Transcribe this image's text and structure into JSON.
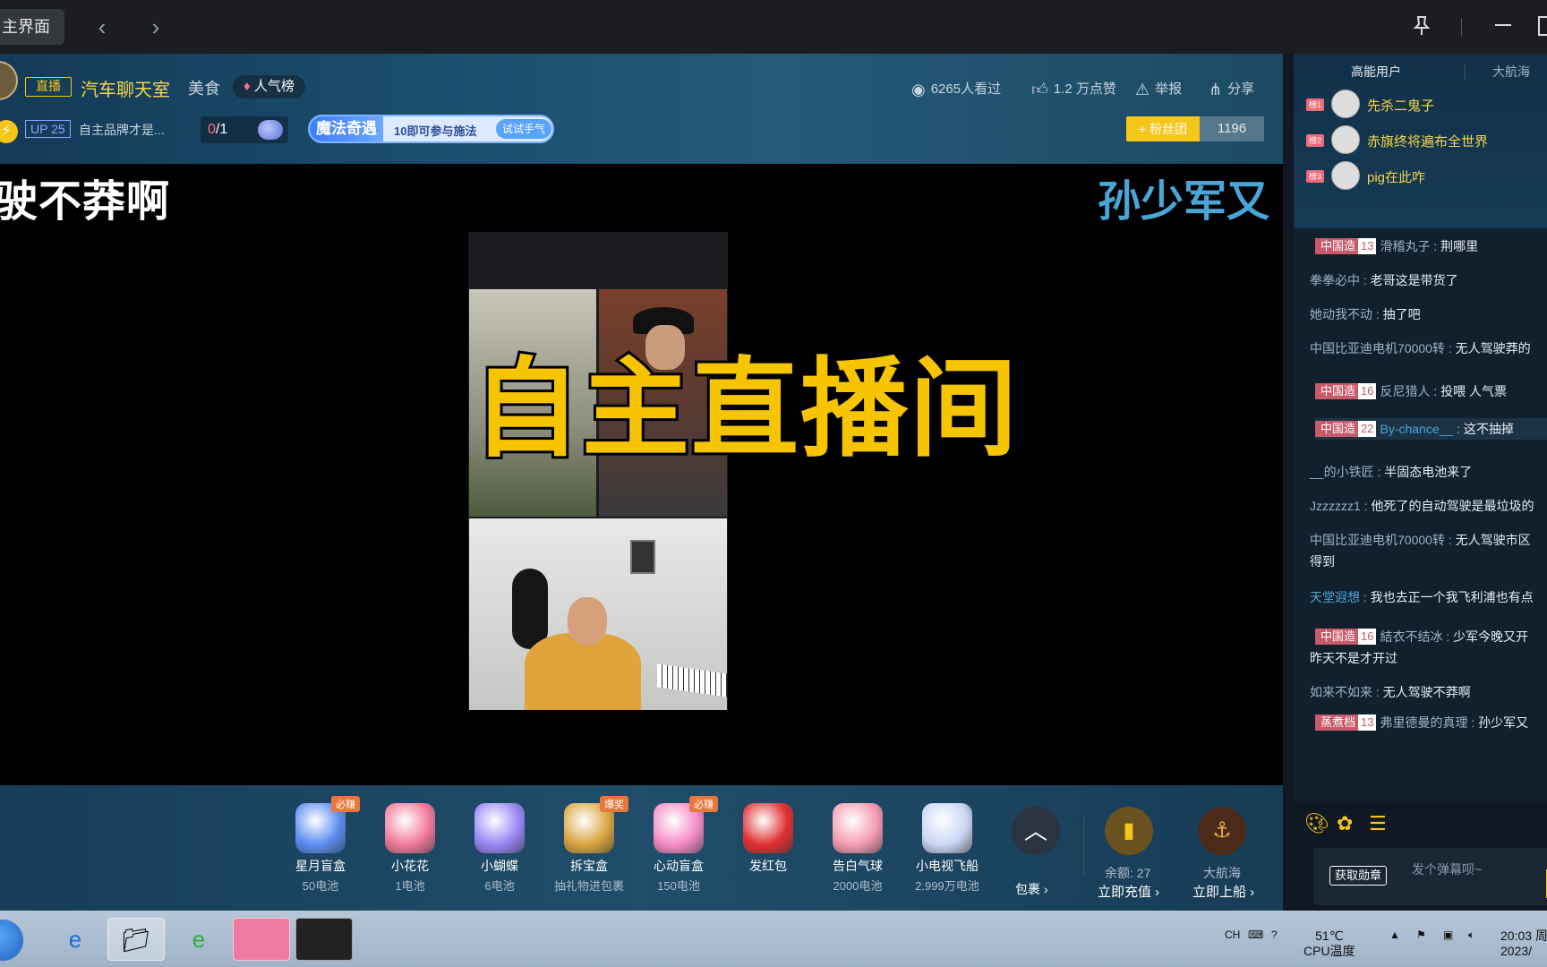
{
  "window": {
    "home_tab": "主界面",
    "back_icon": "‹",
    "forward_icon": "›",
    "pin_icon": "pin-icon",
    "minimize_icon": "minimize-icon"
  },
  "header": {
    "live_tag": "直播",
    "room_title": "汽车聊天室",
    "area": "美食",
    "rank_label": "人气榜",
    "up_level": "UP 25",
    "up_desc": "自主品牌才是...",
    "task_done": "0",
    "task_total": "/1",
    "magic_title": "魔法奇遇",
    "magic_tip": "10即可参与施法",
    "magic_button": "试试手气",
    "views": "6265人看过",
    "likes": "1.2 万点赞",
    "report": "举报",
    "share": "分享",
    "fan_button": "+ 粉丝团",
    "fan_count": "1196"
  },
  "video": {
    "caption_left": "驶不莽啊",
    "caption_right": "孙少军又",
    "overlay_title": "自主直播间"
  },
  "gifts": {
    "items": [
      {
        "name": "星月盲盒",
        "price": "50电池",
        "badge": "必赚",
        "color": "#5b8cf2"
      },
      {
        "name": "小花花",
        "price": "1电池",
        "badge": "",
        "color": "#f27a9a"
      },
      {
        "name": "小蝴蝶",
        "price": "6电池",
        "badge": "",
        "color": "#9a86f5"
      },
      {
        "name": "拆宝盒",
        "price": "抽礼物进包裹",
        "badge": "爆奖",
        "color": "#d9a640"
      },
      {
        "name": "心动盲盒",
        "price": "150电池",
        "badge": "必赚",
        "color": "#f58bc7"
      },
      {
        "name": "发红包",
        "price": "",
        "badge": "",
        "color": "#e03030"
      },
      {
        "name": "告白气球",
        "price": "2000电池",
        "badge": "",
        "color": "#f59cb2"
      },
      {
        "name": "小电视飞船",
        "price": "2.999万电池",
        "badge": "",
        "color": "#c9d6f2"
      }
    ],
    "more_label": "包裹 ›",
    "balance": "余额: 27",
    "recharge": "立即充值 ›",
    "ship_label": "大航海",
    "board": "立即上船 ›"
  },
  "panel": {
    "tab_vip": "高能用户",
    "tab_ship": "大航海",
    "vip_users": [
      {
        "rank": "榜1",
        "name": "先杀二鬼子"
      },
      {
        "rank": "榜2",
        "name": "赤旗终将遍布全世界"
      },
      {
        "rank": "榜3",
        "name": "pig在此咋"
      }
    ],
    "messages": [
      {
        "medal": "中国造",
        "lvl": "13",
        "user": "滑稽丸子",
        "text": "荆哪里"
      },
      {
        "medal": "",
        "lvl": "",
        "user": "拳拳必中",
        "text": "老哥这是带货了"
      },
      {
        "medal": "",
        "lvl": "",
        "user": "她动我不动",
        "text": "抽了吧"
      },
      {
        "medal": "",
        "lvl": "",
        "user": "中国比亚迪电机70000转",
        "text": "无人驾驶莽的"
      },
      {
        "medal": "中国造",
        "lvl": "16",
        "user": "反尼猎人",
        "text": "投喂 人气票"
      },
      {
        "medal": "中国造",
        "lvl": "22",
        "user": "By-chance__",
        "text": "这不抽掉"
      },
      {
        "medal": "",
        "lvl": "",
        "user": "__的小铁匠",
        "text": "半固态电池来了"
      },
      {
        "medal": "",
        "lvl": "",
        "user": "Jzzzzzz1",
        "text": "他死了的自动驾驶是最垃圾的"
      },
      {
        "medal": "",
        "lvl": "",
        "user": "中国比亚迪电机70000转",
        "text": "无人驾驶市区"
      },
      {
        "medal": "",
        "lvl": "",
        "user": "",
        "text": "得到"
      },
      {
        "medal": "",
        "lvl": "",
        "user": "天堂遐想",
        "text": "我也去正一个我飞利浦也有点"
      },
      {
        "medal": "中国造",
        "lvl": "16",
        "user": "結衣不结冰",
        "text": "少军今晚又开"
      },
      {
        "medal": "",
        "lvl": "",
        "user": "",
        "text": "昨天不是才开过"
      },
      {
        "medal": "",
        "lvl": "",
        "user": "如来不如来",
        "text": "无人驾驶不莽啊"
      },
      {
        "medal": "蒸煮档",
        "lvl": "13",
        "user": "弗里德曼的真理",
        "text": "孙少军又"
      }
    ],
    "medal_button": "获取勋章",
    "input_placeholder": "发个弹幕呗~"
  },
  "taskbar": {
    "lang": "CH",
    "temp_value": "51℃",
    "temp_label": "CPU温度",
    "time": "20:03 周",
    "date": "2023/"
  }
}
